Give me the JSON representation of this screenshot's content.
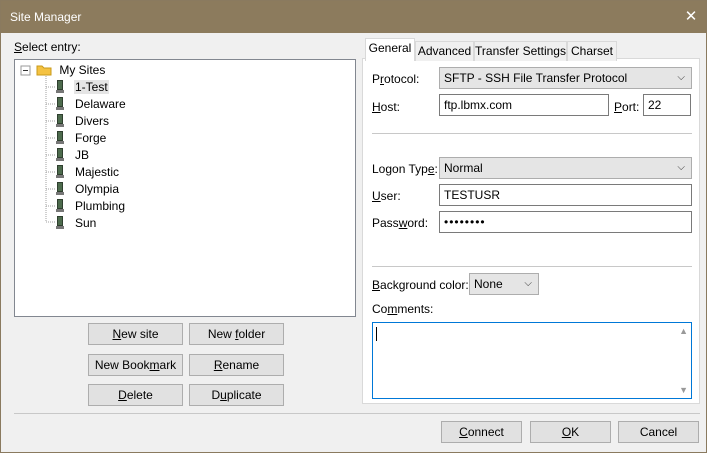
{
  "window": {
    "title": "Site Manager"
  },
  "left": {
    "select_entry_label": "Select entry:",
    "root": "My Sites",
    "sites": [
      "1-Test",
      "Delaware",
      "Divers",
      "Forge",
      "JB",
      "Majestic",
      "Olympia",
      "Plumbing",
      "Sun"
    ],
    "selected": "1-Test"
  },
  "buttons": {
    "new_site": "New site",
    "new_folder": "New folder",
    "new_bookmark": "New Bookmark",
    "rename": "Rename",
    "delete": "Delete",
    "duplicate": "Duplicate"
  },
  "tabs": [
    "General",
    "Advanced",
    "Transfer Settings",
    "Charset"
  ],
  "general": {
    "protocol_label": "Protocol:",
    "protocol_value": "SFTP - SSH File Transfer Protocol",
    "host_label": "Host:",
    "host_value": "ftp.lbmx.com",
    "port_label": "Port:",
    "port_value": "22",
    "logon_type_label": "Logon Type:",
    "logon_type_value": "Normal",
    "user_label": "User:",
    "user_value": "TESTUSR",
    "password_label": "Password:",
    "password_value": "••••••••",
    "bg_color_label": "Background color:",
    "bg_color_value": "None",
    "comments_label": "Comments:",
    "comments_value": ""
  },
  "footer": {
    "connect": "Connect",
    "ok": "OK",
    "cancel": "Cancel"
  },
  "colors": {
    "titlebar": "#8c7b5d",
    "accent": "#0078d7",
    "folder": "#f4c242"
  }
}
